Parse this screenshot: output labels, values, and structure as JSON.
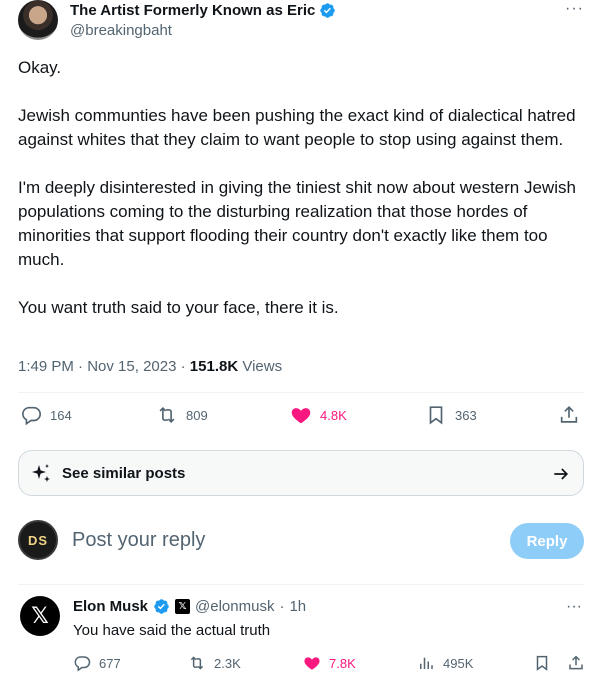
{
  "tweet": {
    "author_name": "The Artist Formerly Known as Eric",
    "author_handle": "@breakingbaht",
    "more_label": "···",
    "paragraphs": [
      "Okay.",
      "Jewish communties have been pushing the exact kind of dialectical hatred against whites that they claim to want people to stop using against them.",
      "I'm deeply disinterested in giving the tiniest shit now about western Jewish populations coming to the disturbing realization that those hordes of minorities that support flooding their country don't exactly like them too much.",
      "You want truth said to your face, there it is."
    ],
    "time": "1:49 PM",
    "date": "Nov 15, 2023",
    "views_count": "151.8K",
    "views_label": "Views",
    "stats": {
      "replies": "164",
      "reposts": "809",
      "likes": "4.8K",
      "bookmarks": "363"
    }
  },
  "similar_posts": {
    "label": "See similar posts"
  },
  "reply_box": {
    "avatar_text": "DS",
    "placeholder": "Post your reply",
    "button_label": "Reply"
  },
  "comment": {
    "author_name": "Elon Musk",
    "author_handle": "@elonmusk",
    "time": "1h",
    "text": "You have said the actual truth",
    "stats": {
      "replies": "677",
      "reposts": "2.3K",
      "likes": "7.8K",
      "views": "495K"
    }
  },
  "colors": {
    "verified_blue": "#1d9bf0",
    "like_pink": "#f91880",
    "muted": "#536471",
    "reply_button": "#8ecdf8"
  }
}
